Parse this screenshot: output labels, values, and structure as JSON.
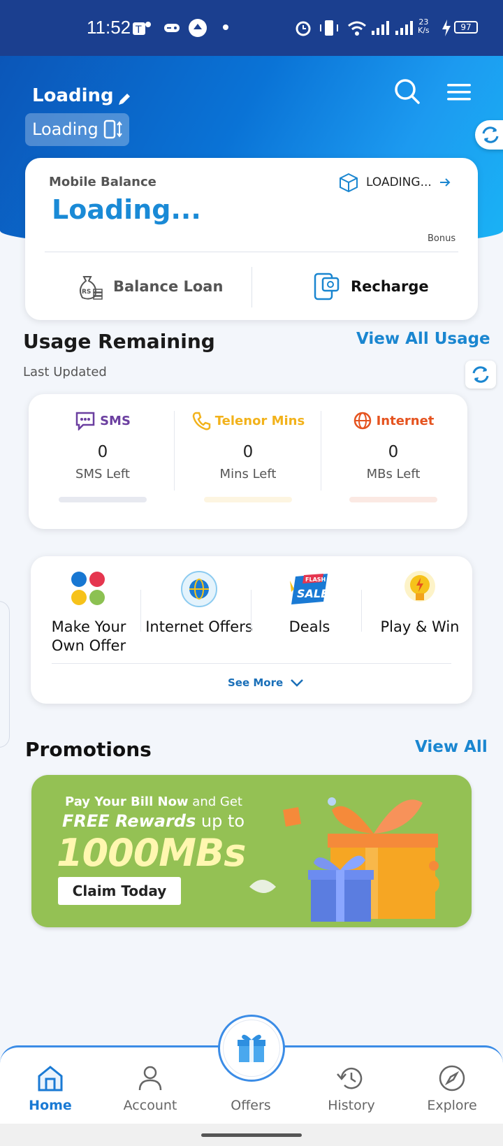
{
  "status_bar": {
    "time": "11:52",
    "net_speed_value": "23",
    "net_speed_unit": "K/s",
    "battery": "97"
  },
  "header": {
    "user_name": "Loading",
    "number_chip": "Loading"
  },
  "balance": {
    "label": "Mobile Balance",
    "value": "Loading...",
    "package_label": "LOADING...",
    "bonus_label": "Bonus",
    "loan_label": "Balance Loan",
    "recharge_label": "Recharge"
  },
  "usage": {
    "title": "Usage Remaining",
    "view_all": "View All Usage",
    "last_updated": "Last Updated",
    "items": [
      {
        "name": "SMS",
        "value": "0",
        "sub": "SMS Left",
        "color": "#6b3fa0",
        "bar": "#e7e9f0"
      },
      {
        "name": "Telenor Mins",
        "value": "0",
        "sub": "Mins Left",
        "color": "#f2b21b",
        "bar": "#fdf5e1"
      },
      {
        "name": "Internet",
        "value": "0",
        "sub": "MBs Left",
        "color": "#e5531f",
        "bar": "#fbe9e3"
      }
    ]
  },
  "offers": {
    "items": [
      {
        "label": "Make Your Own Offer",
        "icon": "color-dots-icon"
      },
      {
        "label": "Internet Offers",
        "icon": "globe-icon"
      },
      {
        "label": "Deals",
        "icon": "flash-sale-icon"
      },
      {
        "label": "Play & Win",
        "icon": "lightbulb-icon"
      }
    ],
    "see_more": "See More"
  },
  "promotions": {
    "title": "Promotions",
    "view_all": "View All",
    "banner": {
      "line1_pre": "Pay Your Bill Now",
      "line1_post": " and Get",
      "line2_pre": "FREE Rewards",
      "line2_post": " up to",
      "line3": "1000MBs",
      "cta": "Claim Today"
    }
  },
  "nav": {
    "items": [
      {
        "label": "Home",
        "icon": "home-icon",
        "active": true
      },
      {
        "label": "Account",
        "icon": "person-icon",
        "active": false
      },
      {
        "label": "Offers",
        "icon": "gift-icon",
        "active": false
      },
      {
        "label": "History",
        "icon": "history-icon",
        "active": false
      },
      {
        "label": "Explore",
        "icon": "compass-icon",
        "active": false
      }
    ]
  },
  "colors": {
    "brand_blue": "#1a86d0",
    "header_dark": "#1b3f8f",
    "promo_green": "#94c154"
  }
}
